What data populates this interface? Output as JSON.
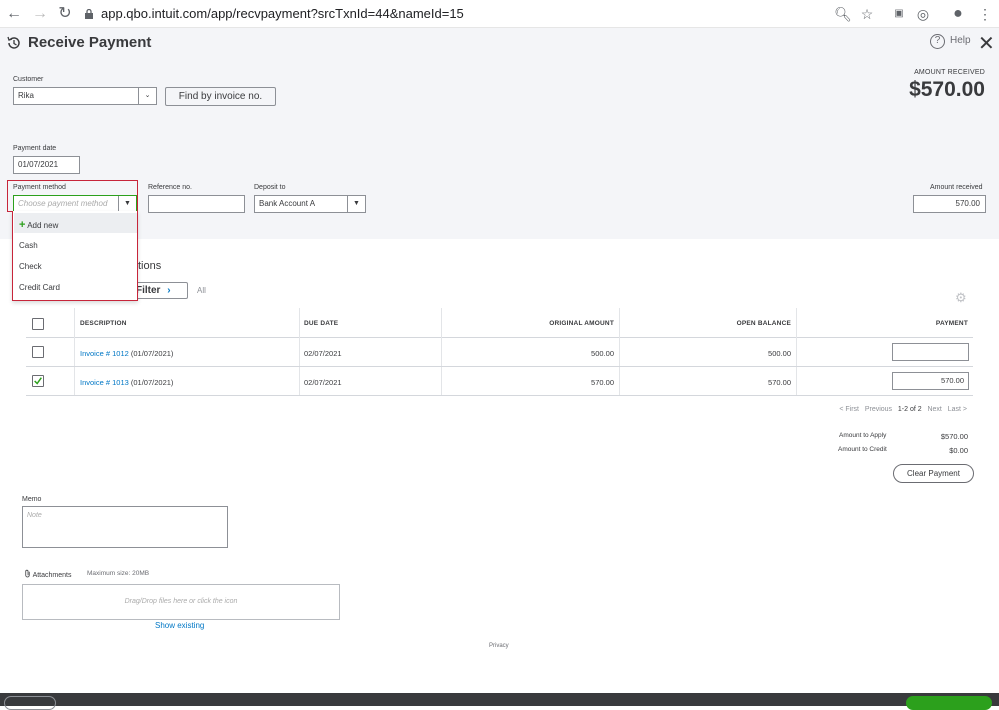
{
  "browser": {
    "url": "app.qbo.intuit.com/app/recvpayment?srcTxnId=44&nameId=15"
  },
  "header": {
    "title": "Receive Payment",
    "help_label": "Help"
  },
  "form": {
    "customer_label": "Customer",
    "customer_value": "Rika",
    "find_invoice_label": "Find by invoice no.",
    "amount_received_header": "AMOUNT RECEIVED",
    "amount_received_big": "$570.00",
    "payment_date_label": "Payment date",
    "payment_date_value": "01/07/2021",
    "payment_method_label": "Payment method",
    "payment_method_placeholder": "Choose payment method",
    "reference_label": "Reference no.",
    "deposit_label": "Deposit to",
    "deposit_value": "Bank Account A",
    "amount_received_label": "Amount received",
    "amount_received_value": "570.00"
  },
  "dropdown": {
    "items": [
      "Add new",
      "Cash",
      "Check",
      "Credit Card"
    ]
  },
  "transactions": {
    "section_title_partial": "tions",
    "filter_label": "Filter",
    "all_label": "All",
    "columns": [
      "DESCRIPTION",
      "DUE DATE",
      "ORIGINAL AMOUNT",
      "OPEN BALANCE",
      "PAYMENT"
    ],
    "rows": [
      {
        "invoice_link": "Invoice # 1012",
        "date_suffix": " (01/07/2021)",
        "due_date": "02/07/2021",
        "original": "500.00",
        "open": "500.00",
        "payment": "",
        "checked": false
      },
      {
        "invoice_link": "Invoice # 1013",
        "date_suffix": " (01/07/2021)",
        "due_date": "02/07/2021",
        "original": "570.00",
        "open": "570.00",
        "payment": "570.00",
        "checked": true
      }
    ],
    "pager": {
      "first": "< First",
      "previous": "Previous",
      "current": "1-2 of 2",
      "next": "Next",
      "last": "Last >"
    }
  },
  "totals": {
    "apply_label": "Amount to Apply",
    "apply_value": "$570.00",
    "credit_label": "Amount to Credit",
    "credit_value": "$0.00",
    "clear_label": "Clear Payment"
  },
  "memo": {
    "label": "Memo",
    "placeholder": "Note"
  },
  "attachments": {
    "label": "Attachments",
    "max_size": "Maximum size: 20MB",
    "drop_text": "Drag/Drop files here or click the icon",
    "show_existing": "Show existing"
  },
  "footer": {
    "privacy": "Privacy"
  },
  "colors": {
    "accent_link": "#0077c5",
    "highlight_red": "#c7253a",
    "save_green": "#2ca01c",
    "panel_bg": "#f4f5f8"
  }
}
